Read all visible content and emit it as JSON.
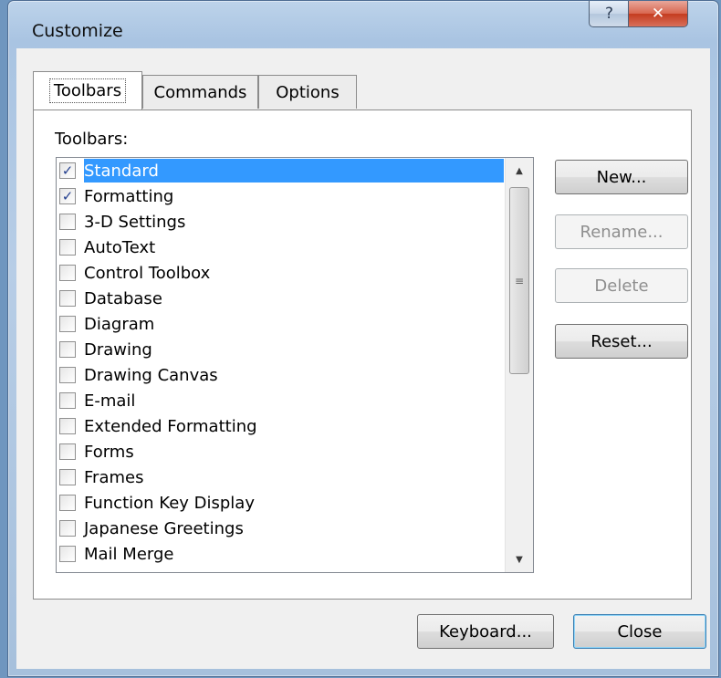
{
  "window": {
    "title": "Customize",
    "help_glyph": "?",
    "close_glyph": "✕"
  },
  "tabs": [
    {
      "label": "Toolbars",
      "active": true
    },
    {
      "label": "Commands",
      "active": false
    },
    {
      "label": "Options",
      "active": false
    }
  ],
  "toolbars_panel": {
    "list_label": "Toolbars:",
    "items": [
      {
        "label": "Standard",
        "checked": true,
        "selected": true
      },
      {
        "label": "Formatting",
        "checked": true,
        "selected": false
      },
      {
        "label": "3-D Settings",
        "checked": false,
        "selected": false
      },
      {
        "label": "AutoText",
        "checked": false,
        "selected": false
      },
      {
        "label": "Control Toolbox",
        "checked": false,
        "selected": false
      },
      {
        "label": "Database",
        "checked": false,
        "selected": false
      },
      {
        "label": "Diagram",
        "checked": false,
        "selected": false
      },
      {
        "label": "Drawing",
        "checked": false,
        "selected": false
      },
      {
        "label": "Drawing Canvas",
        "checked": false,
        "selected": false
      },
      {
        "label": "E-mail",
        "checked": false,
        "selected": false
      },
      {
        "label": "Extended Formatting",
        "checked": false,
        "selected": false
      },
      {
        "label": "Forms",
        "checked": false,
        "selected": false
      },
      {
        "label": "Frames",
        "checked": false,
        "selected": false
      },
      {
        "label": "Function Key Display",
        "checked": false,
        "selected": false
      },
      {
        "label": "Japanese Greetings",
        "checked": false,
        "selected": false
      },
      {
        "label": "Mail Merge",
        "checked": false,
        "selected": false
      }
    ],
    "buttons": {
      "new": "New...",
      "rename": "Rename...",
      "delete": "Delete",
      "reset": "Reset..."
    }
  },
  "footer": {
    "keyboard": "Keyboard...",
    "close": "Close"
  },
  "scrollbar": {
    "up_glyph": "▲",
    "down_glyph": "▼",
    "thumb_grip": "≡"
  },
  "check_glyph": "✓",
  "colors": {
    "selection": "#3399ff",
    "check": "#25408f",
    "title_close": "#c43b1f"
  }
}
